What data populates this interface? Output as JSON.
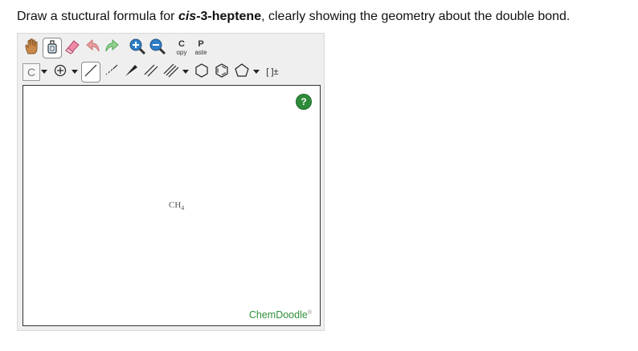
{
  "prompt": {
    "prefix": "Draw a stuctural formula for ",
    "compound_italic": "cis",
    "compound_rest": "-3-heptene",
    "suffix": ", clearly showing the geometry about the double bond."
  },
  "toolbar": {
    "copy_big": "C",
    "copy_small": "opy",
    "paste_big": "P",
    "paste_small": "aste",
    "element": "C",
    "charge_label": "[ ]±"
  },
  "canvas": {
    "help": "?",
    "molecule_main": "CH",
    "molecule_sub": "4",
    "brand": "ChemDoodle",
    "brand_mark": "®"
  },
  "colors": {
    "brand": "#2f8f3a",
    "help": "#2e8b3a"
  },
  "icons": [
    "hand-icon",
    "lasso-icon",
    "eraser-icon",
    "undo-icon",
    "redo-icon",
    "zoom-in-icon",
    "zoom-out-icon",
    "atom-charge-icon",
    "single-bond-icon",
    "wedge-bond-icon",
    "dashed-bond-icon",
    "double-bond-icon",
    "triple-bond-icon",
    "cyclohexane-icon",
    "benzene-icon",
    "cyclopentane-icon"
  ]
}
